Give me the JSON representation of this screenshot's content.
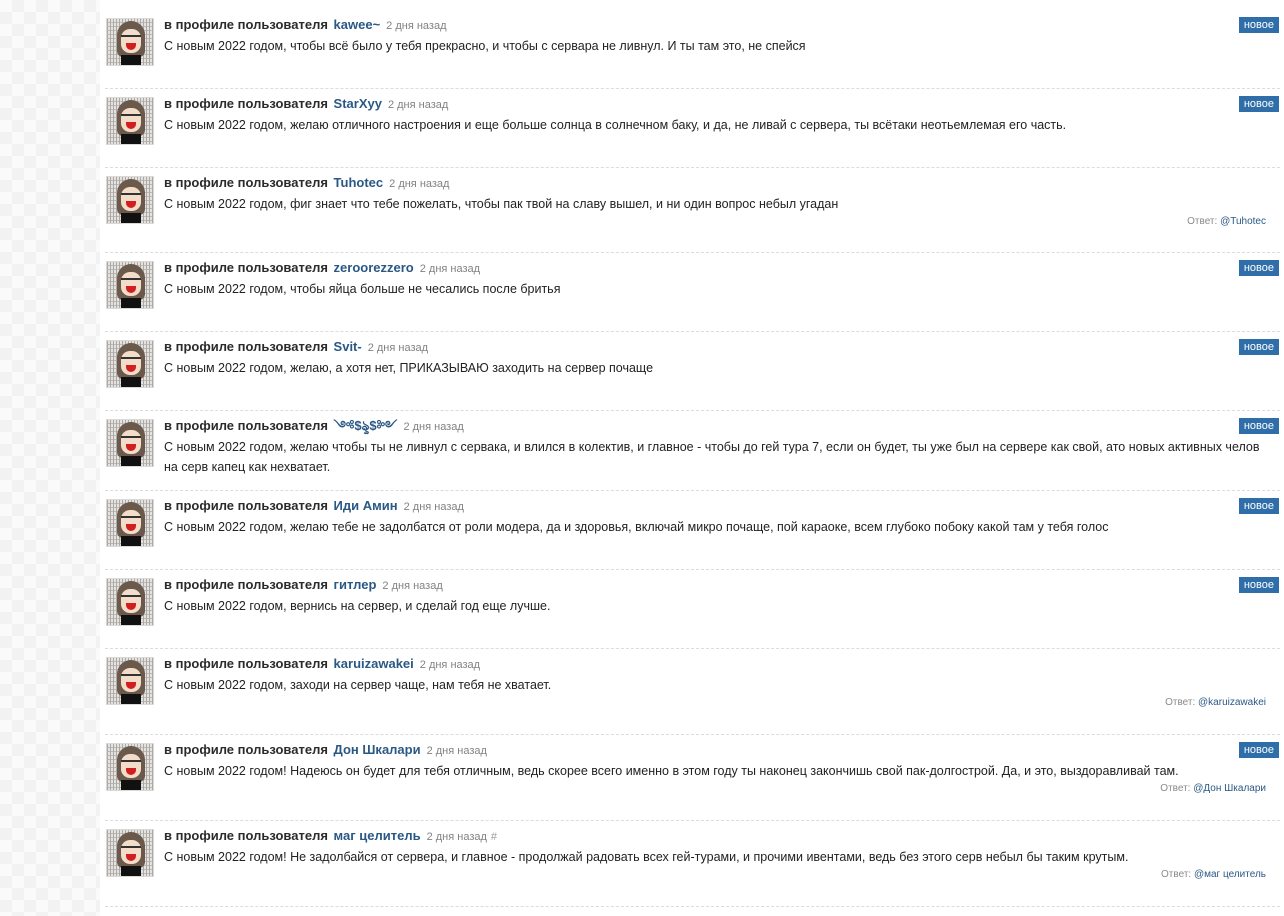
{
  "prefix": "в профиле пользователя",
  "badge": "новое",
  "reply_label": "Ответ:",
  "items": [
    {
      "user": "kawee~",
      "time": "2 дня назад",
      "text": "С новым 2022 годом, чтобы всё было у тебя прекрасно, и чтобы с сервара не ливнул. И ты там это, не спейся",
      "badge": true,
      "reply": ""
    },
    {
      "user": "StarXyy",
      "time": "2 дня назад",
      "text": "С новым 2022 годом, желаю отличного настроения и еще больше солнца в солнечном баку, и да, не ливай с сервера, ты всётаки неотьемлемая его часть.",
      "badge": true,
      "reply": ""
    },
    {
      "user": "Tuhotec",
      "time": "2 дня назад",
      "text": "С новым 2022 годом, фиг знает что тебе пожелать, чтобы пак твой на славу вышел, и ни один вопрос небыл угадан",
      "badge": false,
      "reply": "@Tuhotec"
    },
    {
      "user": "zeroorezzero",
      "time": "2 дня назад",
      "text": "С новым 2022 годом, чтобы яйца больше не чесались после бритья",
      "badge": true,
      "reply": ""
    },
    {
      "user": "Svit-",
      "time": "2 дня назад",
      "text": "С новым 2022 годом, желаю, а хотя нет, ПРИКАЗЫВАЮ заходить на сервер почаще",
      "badge": true,
      "reply": ""
    },
    {
      "user": "༺$ৡ$༻",
      "time": "2 дня назад",
      "text": "С новым 2022 годом, желаю чтобы ты не ливнул с сервака, и влился в колектив, и главное - чтобы до гей тура 7, если он будет, ты уже был на сервере как свой, ато новых активных челов на серв капец как нехватает.",
      "badge": true,
      "reply": ""
    },
    {
      "user": "Иди Амин",
      "time": "2 дня назад",
      "text": "С новым 2022 годом, желаю тебе не задолбатся от роли модера, да и здоровья, включай микро почаще, пой караоке, всем глубоко побоку какой там у тебя голос",
      "badge": true,
      "reply": ""
    },
    {
      "user": "гитлер",
      "time": "2 дня назад",
      "text": "С новым 2022 годом, вернись на сервер, и сделай год еще лучше.",
      "badge": true,
      "reply": ""
    },
    {
      "user": "karuizawakei",
      "time": "2 дня назад",
      "text": "С новым 2022 годом, заходи на сервер чаще, нам тебя не хватает.",
      "badge": false,
      "reply": "@karuizawakei"
    },
    {
      "user": "Дон Шкалари",
      "time": "2 дня назад",
      "text": "С новым 2022 годом! Надеюсь он будет для тебя отличным, ведь скорее всего именно в этом году ты наконец закончишь свой пак-долгострой. Да, и это, выздоравливай там.",
      "badge": true,
      "reply": "@Дон Шкалари"
    },
    {
      "user": "маг целитель",
      "time": "2 дня назад",
      "hash": "#",
      "text": "С новым 2022 годом! Не задолбайся от сервера, и главное - продолжай радовать всех гей-турами, и прочими ивентами, ведь без этого серв небыл бы таким крутым.",
      "badge": false,
      "reply": "@маг целитель"
    }
  ]
}
